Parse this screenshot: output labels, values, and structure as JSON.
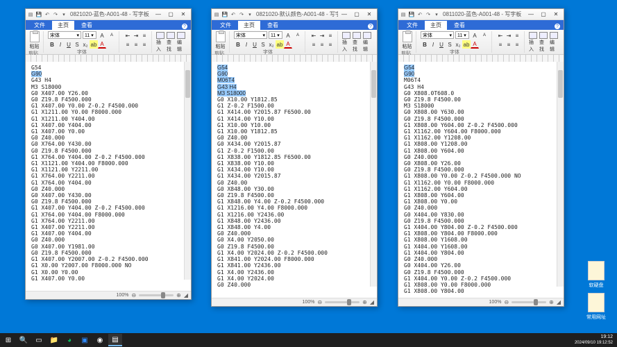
{
  "windows": [
    {
      "title": "0821020-蓝色-A001-48 - 写字板",
      "tabs": {
        "file": "文件",
        "start": "主页",
        "view": "查看"
      },
      "font": {
        "name": "宋体",
        "size": "11"
      },
      "groups": {
        "clipboard": "剪贴板",
        "font": "字体"
      },
      "zoom": "100%",
      "gcode": "G54\nG90\nG43 H4\nM3 S18000\nG0 X407.00 Y26.00\nG0 Z19.8 F4500.000\nG1 X407.00 Y0.00 Z-0.2 F4500.000\nG1 X1211.00 Y0.00 F8000.000\nG1 X1211.00 Y404.00\nG1 X407.00 Y404.00\nG1 X407.00 Y0.00\nG0 Z40.000\nG0 X764.00 Y430.00\nG0 Z19.8 F4500.000\nG1 X764.00 Y404.00 Z-0.2 F4500.000\nG1 X1121.00 Y404.00 F8000.000\nG1 X1121.00 Y2211.00\nG1 X764.00 Y2211.00\nG1 X764.00 Y404.00\nG0 Z40.000\nG0 X407.00 Y430.00\nG0 Z19.8 F4500.000\nG1 X407.00 Y404.00 Z-0.2 F4500.000\nG1 X764.00 Y404.00 F8000.000\nG1 X764.00 Y2211.00\nG1 X407.00 Y2211.00\nG1 X407.00 Y404.00\nG0 Z40.000\nG0 X407.00 Y1981.00\nG0 Z19.8 F4500.000\nG1 X407.00 Y2007.00 Z-0.2 F4500.000\nG1 X0.00 Y2007.00 F8000.000 NO\nG1 X0.00 Y0.00\nG1 X407.00 Y0.00",
      "hl_lines": [
        1
      ]
    },
    {
      "title": "0821020-默认颜色-A001-48 - 写字板",
      "tabs": {
        "file": "文件",
        "start": "主页",
        "view": "查看"
      },
      "font": {
        "name": "宋体",
        "size": "11"
      },
      "groups": {
        "clipboard": "剪贴板",
        "font": "字体"
      },
      "zoom": "100%",
      "gcode": "G54\nG90\nM06T4\nG43 H4\nM3 S18000\nG0 X10.00 Y1812.85\nG1 Z-0.2 F1500.00\nG1 X414.00 Y2015.87 F6500.00\nG1 X414.00 Y10.00\nG1 X10.00 Y10.00\nG1 X10.00 Y1812.85\nG0 Z40.00\nG0 X434.00 Y2015.87\nG1 Z-0.2 F1500.00\nG1 X838.00 Y1812.85 F6500.00\nG1 X838.00 Y10.00\nG1 X434.00 Y10.00\nG1 X434.00 Y2015.87\nG0 Z40.00\nG0 X848.00 Y30.00\nG0 Z19.8 F4500.00\nG1 X848.00 Y4.00 Z-0.2 F4500.000\nG1 X1216.00 Y4.00 F8000.000\nG1 X1216.00 Y2436.00\nG1 X848.00 Y2436.00\nG1 X848.00 Y4.00\nG0 Z40.000\nG0 X4.00 Y2050.00\nG0 Z19.8 F4500.00\nG1 X4.00 Y2024.00 Z-0.2 F4500.000\nG1 X841.00 Y2024.00 F8000.000\nG1 X841.00 Y2436.00\nG1 X4.00 Y2436.00\nG1 X4.00 Y2024.00\nG0 Z40.000",
      "hl_lines": [
        0,
        1,
        2,
        3,
        4
      ]
    },
    {
      "title": "0811020-蓝色-A001-48 - 写字板",
      "tabs": {
        "file": "文件",
        "start": "主页",
        "view": "查看"
      },
      "font": {
        "name": "宋体",
        "size": "11"
      },
      "groups": {
        "clipboard": "剪贴板",
        "font": "字体"
      },
      "zoom": "100%",
      "gcode": "G54\nG90\nM06T4\nG43 H4\nG0 X808.0T608.0\nG0 Z19.8 F4500.00\nM3 S18000\nG0 X808.00 Y630.00\nG0 Z19.8 F4500.000\nG1 X808.00 Y604.00 Z-0.2 F4500.000\nG1 X1162.00 Y604.00 F8000.000\nG1 X1162.00 Y1208.00\nG1 X808.00 Y1208.00\nG1 X808.00 Y604.00\nG0 Z40.000\nG0 X808.00 Y26.00\nG0 Z19.8 F4500.000\nG1 X808.00 Y0.00 Z-0.2 F4500.000 NO\nG1 X1162.00 Y0.00 F8000.000\nG1 X1162.00 Y604.00\nG1 X808.00 Y604.00\nG1 X808.00 Y0.00\nG0 Z40.000\nG0 X404.00 Y830.00\nG0 Z19.8 F4500.000\nG1 X404.00 Y804.00 Z-0.2 F4500.000\nG1 X808.00 Y804.00 F8000.000\nG1 X808.00 Y1608.00\nG1 X404.00 Y1608.00\nG1 X404.00 Y804.00\nG0 Z40.000\nG0 X404.00 Y26.00\nG0 Z19.8 F4500.000\nG1 X404.00 Y0.00 Z-0.2 F4500.000\nG1 X808.00 Y0.00 F8000.000\nG1 X808.00 Y804.00",
      "hl_lines": [
        0,
        1
      ]
    }
  ],
  "paste_label": "粘贴",
  "insert_label": "插入",
  "lookup_label": "查找",
  "edit_label": "编辑",
  "desktop_icons": [
    {
      "name": "软硬盘"
    },
    {
      "name": "常用网址"
    }
  ],
  "clock": {
    "time": "19:12",
    "date": "2024/09/10 19:12:52"
  }
}
